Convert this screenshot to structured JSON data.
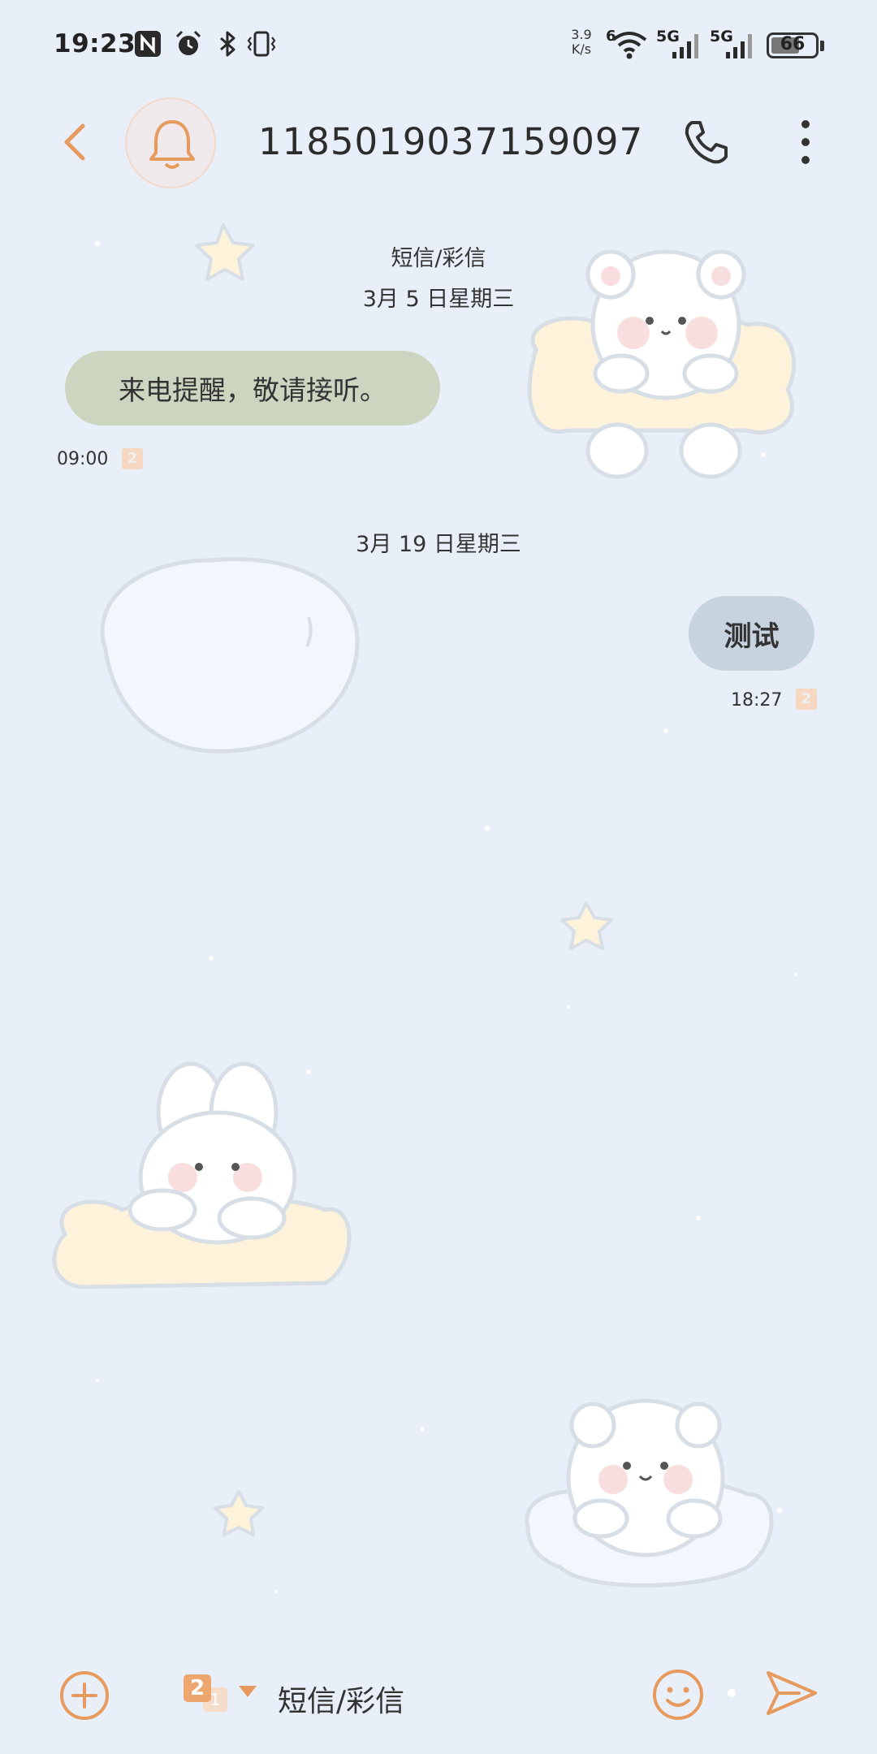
{
  "status_bar": {
    "time": "19:23",
    "net_speed_value": "3.9",
    "net_speed_unit": "K/s",
    "wifi_label": "6",
    "sim1_label": "5G",
    "sim2_label": "5G",
    "battery": "66",
    "battery_level": 0.66,
    "icons": [
      "nfc-icon",
      "alarm-icon",
      "bluetooth-icon",
      "vibrate-icon",
      "wifi-icon",
      "signal-icon",
      "battery-icon"
    ]
  },
  "header": {
    "contact": "1185019037159097",
    "icons": [
      "back-icon",
      "bell-icon",
      "phone-icon",
      "more-icon"
    ]
  },
  "conversation": {
    "type_label": "短信/彩信",
    "groups": [
      {
        "date": "3月 5 日星期三",
        "messages": [
          {
            "direction": "incoming",
            "text": "来电提醒，敬请接听。",
            "time": "09:00",
            "sim": "2"
          }
        ]
      },
      {
        "date": "3月 19 日星期三",
        "messages": [
          {
            "direction": "outgoing",
            "text": "测试",
            "time": "18:27",
            "sim": "2"
          }
        ]
      }
    ]
  },
  "composer": {
    "sim_primary": "2",
    "sim_secondary": "1",
    "label": "短信/彩信",
    "icons": [
      "plus-icon",
      "sim-select-icon",
      "emoji-icon",
      "send-icon"
    ]
  },
  "colors": {
    "background": "#e9eff8",
    "accent": "#e79a5d",
    "incoming_bubble": "#ccd5c0",
    "outgoing_bubble": "#c7d3df"
  }
}
